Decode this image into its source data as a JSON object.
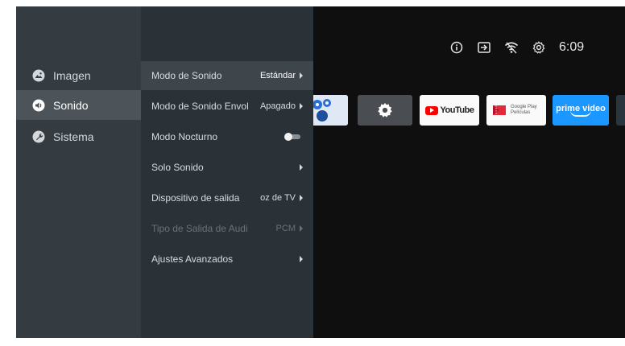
{
  "status": {
    "icons": [
      "info-icon",
      "input-source-icon",
      "wifi-icon",
      "settings-gear-icon"
    ],
    "time": "6:09"
  },
  "apps": {
    "youtube_label": "YouTube",
    "google_play_label_1": "Google Play",
    "google_play_label_2": "Películas",
    "prime_label": "prime video"
  },
  "categories": [
    {
      "label": "Imagen",
      "icon": "picture-icon"
    },
    {
      "label": "Sonido",
      "icon": "sound-icon"
    },
    {
      "label": "Sistema",
      "icon": "wrench-icon"
    }
  ],
  "selected_category": "Sonido",
  "settings": [
    {
      "label": "Modo de Sonido",
      "value": "Estándar"
    },
    {
      "label": "Modo de Sonido Envol",
      "value": "Apagado"
    },
    {
      "label": "Modo Nocturno",
      "value": ""
    },
    {
      "label": "Solo Sonido",
      "value": ""
    },
    {
      "label": "Dispositivo de salida",
      "value": "oz de TV"
    },
    {
      "label": "Tipo de Salida de Audi",
      "value": "PCM"
    },
    {
      "label": "Ajustes Avanzados",
      "value": ""
    }
  ],
  "night_mode_enabled": false,
  "colors": {
    "accent_youtube": "#ff0000",
    "prime": "#1a98ff"
  }
}
